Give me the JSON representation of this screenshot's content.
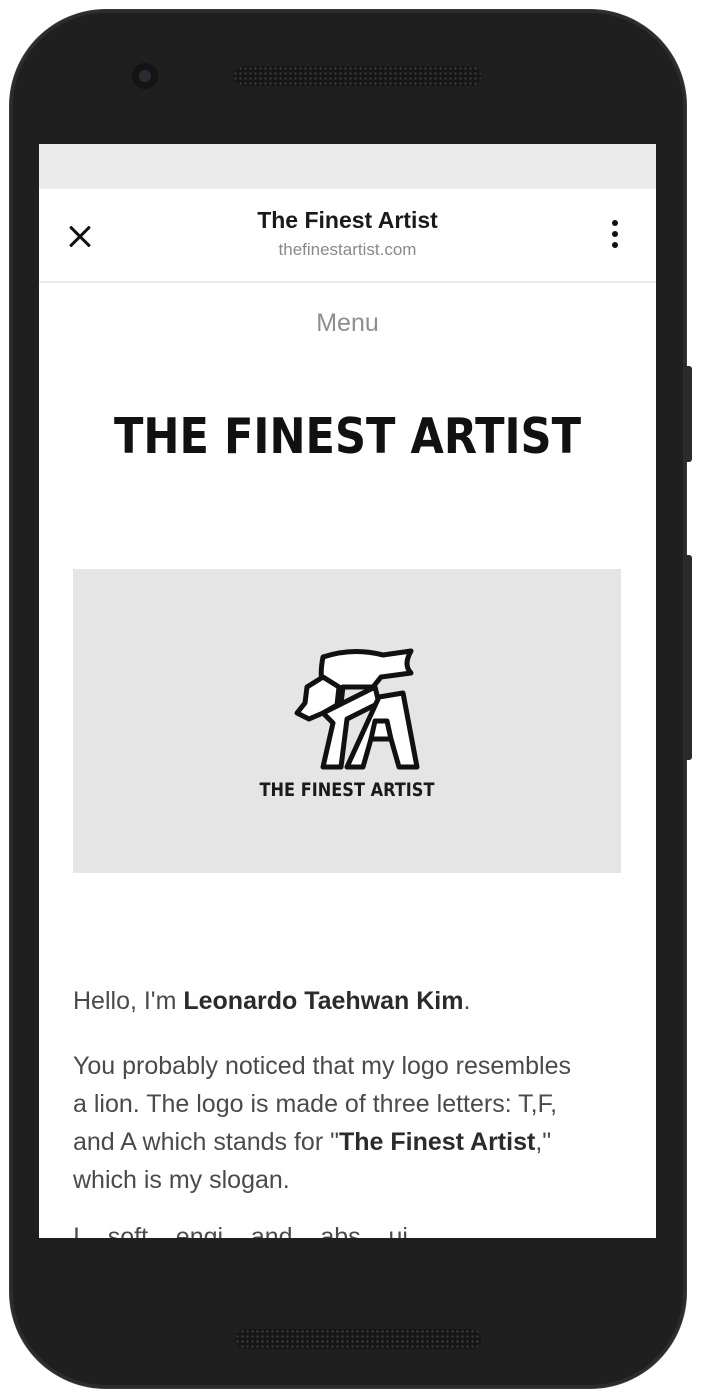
{
  "browser": {
    "title": "The Finest Artist",
    "url": "thefinestartist.com"
  },
  "page": {
    "menu_label": "Menu",
    "site_title": "THE FINEST ARTIST",
    "hero_logo_text": "THE FINEST ARTIST",
    "intro": {
      "greeting": "Hello, I'm ",
      "name": "Leonardo Taehwan Kim",
      "end": "."
    },
    "para2": {
      "line1": "You probably noticed that my logo resembles",
      "line2": "a lion. The logo is made of three letters: T,F,",
      "line3_pre": "and A which stands for \"",
      "line3_bold": "The Finest Artist",
      "line3_post": ",\"",
      "line4": "which is my slogan."
    },
    "para3_partial": "I... soft... engi... and... abs... ui..."
  },
  "icons": {
    "close": "close-icon",
    "more": "more-vert-icon",
    "logo": "lion-tfa-logo"
  }
}
